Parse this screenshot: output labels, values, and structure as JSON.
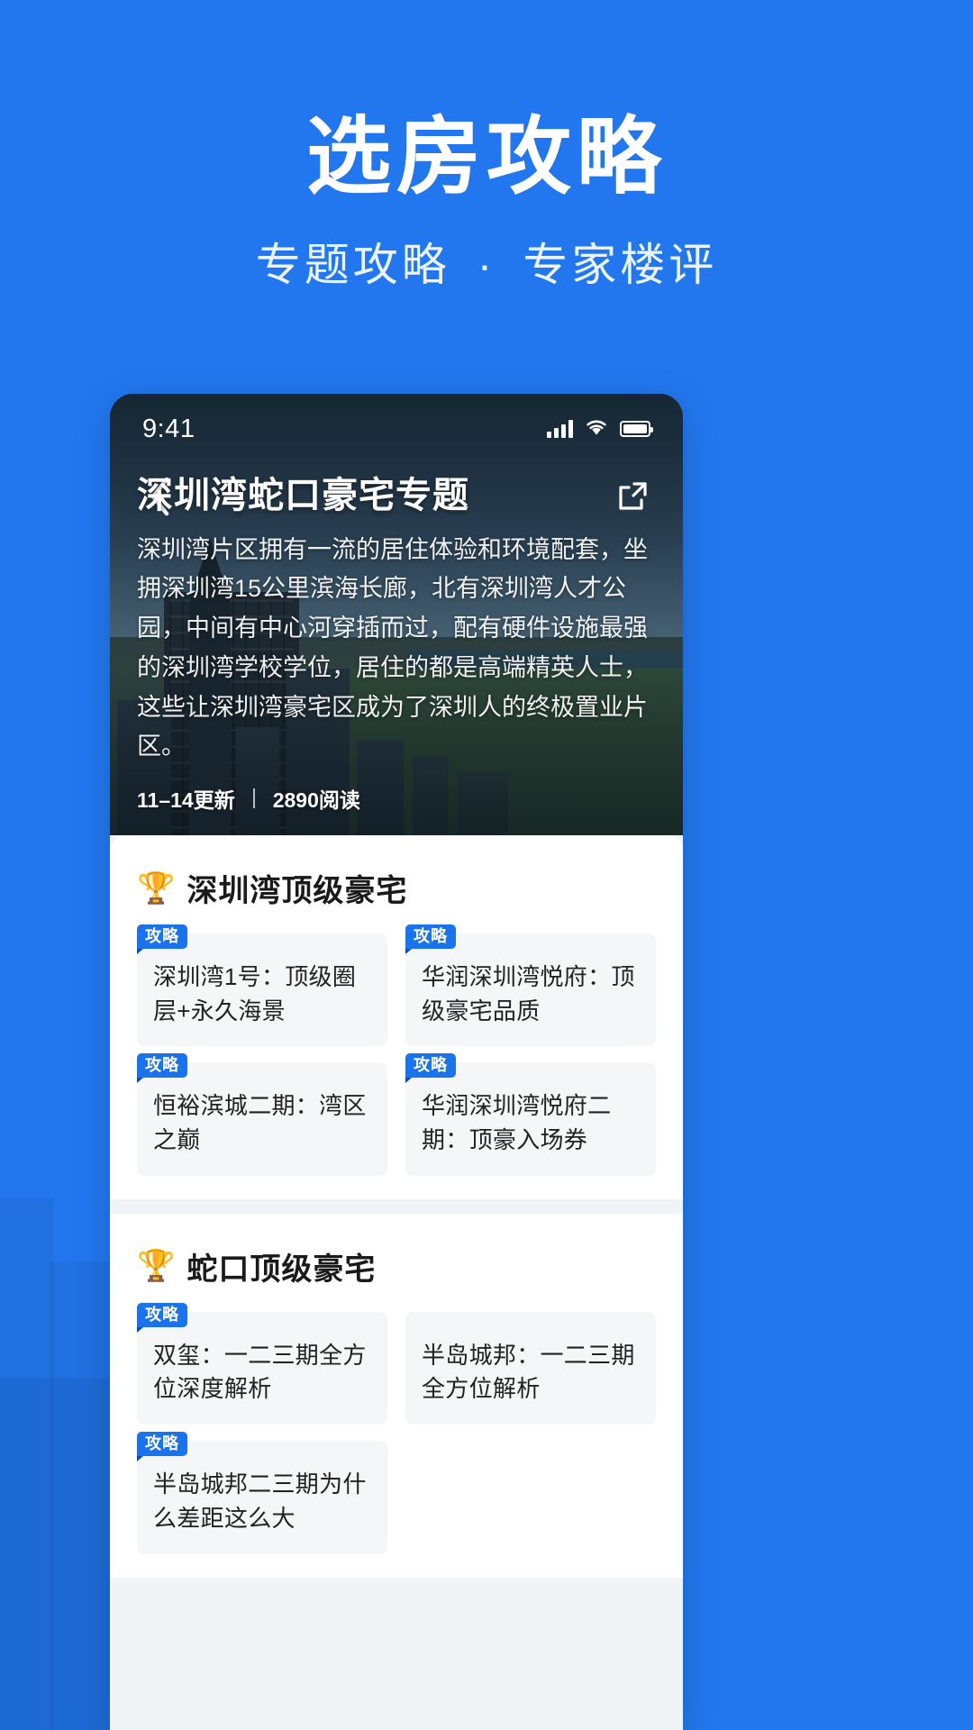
{
  "hero": {
    "title": "选房攻略",
    "subtitle_left": "专题攻略",
    "subtitle_sep": "·",
    "subtitle_right": "专家楼评"
  },
  "colors": {
    "background": "#2277ee",
    "badge": "#1a73ea",
    "sheet": "#f1f4f7",
    "tile": "#f5f6f8"
  },
  "phone": {
    "status": {
      "time": "9:41",
      "signal_icon": "cellular-signal-icon",
      "wifi_icon": "wifi-icon",
      "battery_icon": "battery-icon"
    },
    "nav": {
      "back_icon": "back-chevron-icon",
      "share_icon": "share-external-icon"
    },
    "article": {
      "title": "深圳湾蛇口豪宅专题",
      "description": "深圳湾片区拥有一流的居住体验和环境配套，坐拥深圳湾15公里滨海长廊，北有深圳湾人才公园，中间有中心河穿插而过，配有硬件设施最强的深圳湾学校学位，居住的都是高端精英人士，这些让深圳湾豪宅区成为了深圳人的终极置业片区。",
      "update": "11–14更新",
      "reads": "2890阅读"
    },
    "sections": [
      {
        "icon": "🏆",
        "title": "深圳湾顶级豪宅",
        "items": [
          {
            "badge": "攻略",
            "text": "深圳湾1号：顶级圈层+永久海景"
          },
          {
            "badge": "攻略",
            "text": "华润深圳湾悦府：顶级豪宅品质"
          },
          {
            "badge": "攻略",
            "text": "恒裕滨城二期：湾区之巅"
          },
          {
            "badge": "攻略",
            "text": "华润深圳湾悦府二期：顶豪入场券"
          }
        ]
      },
      {
        "icon": "🏆",
        "title": "蛇口顶级豪宅",
        "items": [
          {
            "badge": "攻略",
            "text": "双玺：一二三期全方位深度解析"
          },
          {
            "badge": "",
            "text": "半岛城邦：一二三期全方位解析"
          },
          {
            "badge": "攻略",
            "text": "半岛城邦二三期为什么差距这么大"
          }
        ]
      }
    ]
  }
}
